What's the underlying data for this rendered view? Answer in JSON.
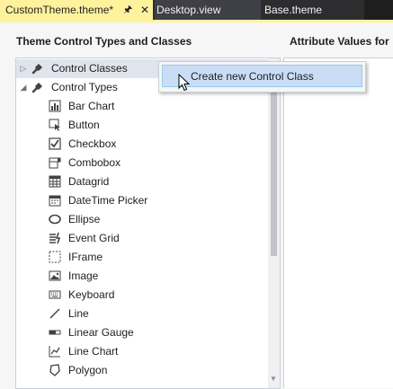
{
  "tabs": [
    {
      "label": "CustomTheme.theme*",
      "active": true
    },
    {
      "label": "Desktop.view",
      "active": false
    },
    {
      "label": "Base.theme",
      "active": false
    }
  ],
  "panels": {
    "left_heading": "Theme Control Types and Classes",
    "right_heading": "Attribute Values for"
  },
  "tree": {
    "root_items": [
      {
        "label": "Control Classes",
        "icon": "wrench-icon",
        "expanded": false,
        "selected": true
      },
      {
        "label": "Control Types",
        "icon": "wrench-icon",
        "expanded": true,
        "selected": false
      }
    ],
    "children": [
      {
        "label": "Bar Chart",
        "icon": "bar-chart-icon"
      },
      {
        "label": "Button",
        "icon": "button-icon"
      },
      {
        "label": "Checkbox",
        "icon": "checkbox-icon"
      },
      {
        "label": "Combobox",
        "icon": "combobox-icon"
      },
      {
        "label": "Datagrid",
        "icon": "datagrid-icon"
      },
      {
        "label": "DateTime Picker",
        "icon": "datetime-picker-icon"
      },
      {
        "label": "Ellipse",
        "icon": "ellipse-icon"
      },
      {
        "label": "Event Grid",
        "icon": "event-grid-icon"
      },
      {
        "label": "IFrame",
        "icon": "iframe-icon"
      },
      {
        "label": "Image",
        "icon": "image-icon"
      },
      {
        "label": "Keyboard",
        "icon": "keyboard-icon"
      },
      {
        "label": "Line",
        "icon": "line-icon"
      },
      {
        "label": "Linear Gauge",
        "icon": "linear-gauge-icon"
      },
      {
        "label": "Line Chart",
        "icon": "line-chart-icon"
      },
      {
        "label": "Polygon",
        "icon": "polygon-icon"
      }
    ]
  },
  "context_menu": {
    "items": [
      {
        "label": "Create new Control Class"
      }
    ]
  },
  "colors": {
    "active_tab": "#fff29d",
    "tab_strip": "#2d2d30",
    "menu_highlight": "#c9def5",
    "selected_row": "#e0e4ed"
  }
}
